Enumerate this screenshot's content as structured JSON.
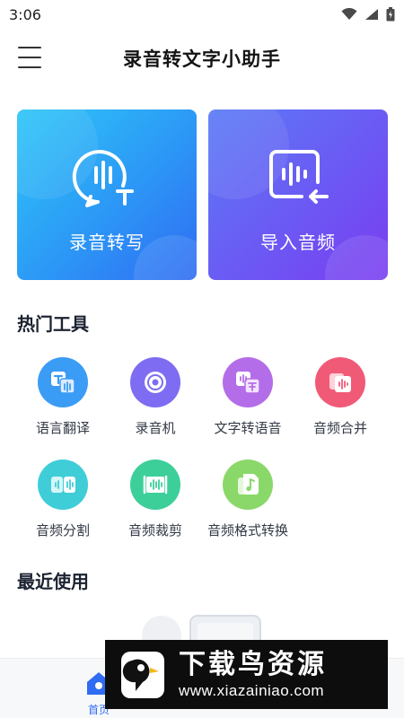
{
  "status_bar": {
    "time": "3:06",
    "icons": [
      "wifi-icon",
      "cellular-icon",
      "battery-icon"
    ]
  },
  "header": {
    "title": "录音转文字小助手",
    "menu_icon": "hamburger-menu-icon"
  },
  "cards": [
    {
      "label": "录音转写",
      "icon": "voice-to-text-icon",
      "color": "#2c9cf6"
    },
    {
      "label": "导入音频",
      "icon": "import-audio-icon",
      "color": "#6a5cf4"
    }
  ],
  "hot_tools": {
    "title": "热门工具",
    "items": [
      {
        "label": "语言翻译",
        "icon": "translate-icon",
        "color": "#3b9cf5"
      },
      {
        "label": "录音机",
        "icon": "recorder-icon",
        "color": "#7e6cf2"
      },
      {
        "label": "文字转语音",
        "icon": "text-to-speech-icon",
        "color": "#b46de8"
      },
      {
        "label": "音频合并",
        "icon": "audio-merge-icon",
        "color": "#f05a77"
      },
      {
        "label": "音频分割",
        "icon": "audio-split-icon",
        "color": "#3fcdd8"
      },
      {
        "label": "音频裁剪",
        "icon": "audio-trim-icon",
        "color": "#3ccf9a"
      },
      {
        "label": "音频格式转换",
        "icon": "audio-format-icon",
        "color": "#8ad869"
      }
    ]
  },
  "recent": {
    "title": "最近使用"
  },
  "tabbar": {
    "home_label": "首页"
  },
  "watermark": {
    "title": "下载鸟资源",
    "url": "www.xiazainiao.com"
  }
}
